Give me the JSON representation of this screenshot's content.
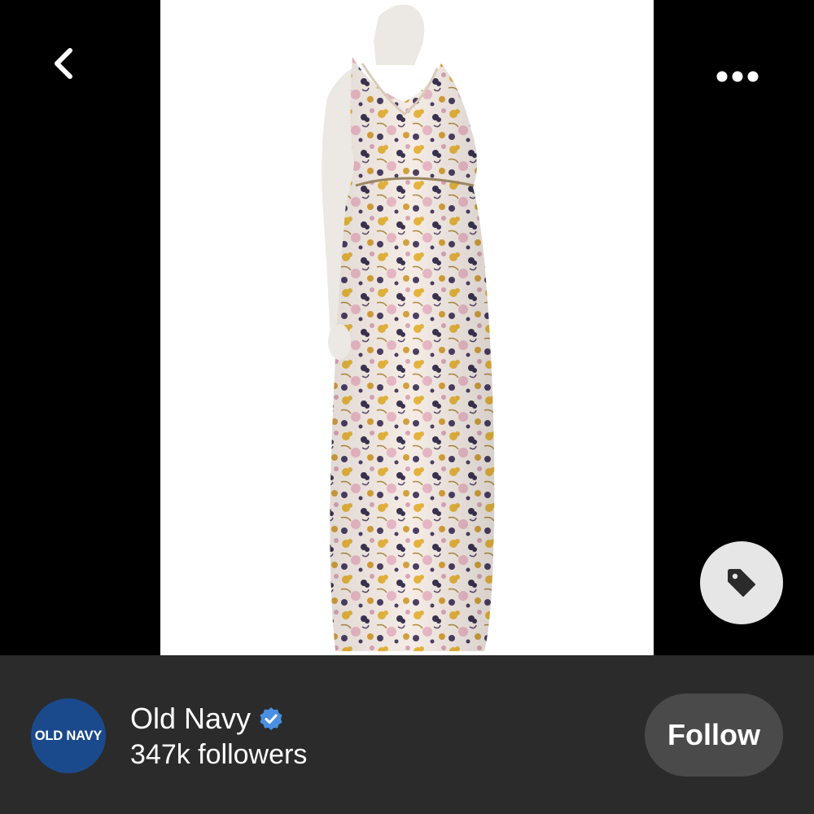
{
  "pin": {
    "image_alt": "Floral maxi dress",
    "icons": {
      "back": "chevron-left-icon",
      "more": "more-options-icon",
      "tag": "tag-icon"
    }
  },
  "account": {
    "logo_text": "OLD NAVY",
    "name": "Old Navy",
    "verified": true,
    "followers": "347k followers",
    "follow_label": "Follow"
  },
  "colors": {
    "background": "#000000",
    "footer": "#2b2b2b",
    "follow_button": "#4a4a4a",
    "brand": "#1b4a8c",
    "verified": "#4a90e2"
  }
}
